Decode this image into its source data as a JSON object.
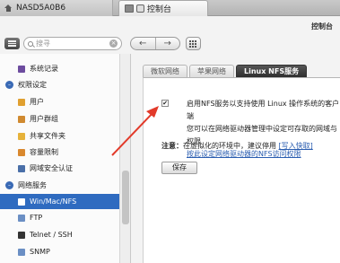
{
  "top_tabs": {
    "nas_label": "NASD5A0B6",
    "control_label": "控制台"
  },
  "header": {
    "title": "控制台"
  },
  "search": {
    "placeholder": "搜寻"
  },
  "nav": {
    "back": "←",
    "forward": "→"
  },
  "sidebar": {
    "items": [
      {
        "label": "系统记录",
        "type": "item",
        "icon": "log-icon",
        "color": "#6d4c9f"
      },
      {
        "label": "权限设定",
        "type": "category",
        "icon": "permission-category-icon",
        "color": "#3a6ab5"
      },
      {
        "label": "用户",
        "type": "item",
        "icon": "user-icon",
        "color": "#e0a030"
      },
      {
        "label": "用户群组",
        "type": "item",
        "icon": "user-group-icon",
        "color": "#d08a30"
      },
      {
        "label": "共享文件夹",
        "type": "item",
        "icon": "folder-icon",
        "color": "#e6b23a"
      },
      {
        "label": "容量限制",
        "type": "item",
        "icon": "quota-icon",
        "color": "#d9882e"
      },
      {
        "label": "网域安全认证",
        "type": "item",
        "icon": "domain-security-icon",
        "color": "#4a6fa8"
      },
      {
        "label": "网络服务",
        "type": "category",
        "icon": "network-category-icon",
        "color": "#3a6ab5"
      },
      {
        "label": "Win/Mac/NFS",
        "type": "active",
        "icon": "win-mac-nfs-icon",
        "color": "#ffffff"
      },
      {
        "label": "FTP",
        "type": "item",
        "icon": "ftp-icon",
        "color": "#6b8fc4"
      },
      {
        "label": "Telnet / SSH",
        "type": "item",
        "icon": "terminal-icon",
        "color": "#333333"
      },
      {
        "label": "SNMP",
        "type": "item",
        "icon": "snmp-icon",
        "color": "#6b8fc4"
      }
    ]
  },
  "tabs": [
    {
      "label": "微软网络",
      "active": false
    },
    {
      "label": "苹果网络",
      "active": false
    },
    {
      "label": "Linux NFS服务",
      "active": true
    }
  ],
  "nfs": {
    "checkbox_mark": "✔",
    "enable_line1": "启用NFS服务以支持使用 Linux 操作系统的客户端",
    "enable_line2": "您可以在网络驱动器管理中设定可存取的网域与权限",
    "link_text": "按此设定网络驱动器的NFS访问权限",
    "note_label": "注意：",
    "note_text": "在虚拟化的环境中，建议停用",
    "note_link": "[写入快取]",
    "save_label": "保存"
  },
  "colors": {
    "accent": "#2f6bc0",
    "annotation_arrow": "#e23a2a"
  }
}
